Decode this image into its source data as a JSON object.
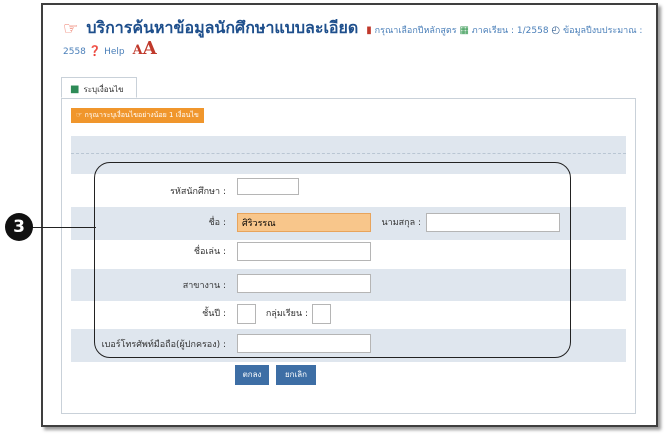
{
  "header": {
    "title": "บริการค้นหาข้อมูลนักศึกษาแบบละเอียด",
    "course_link": "กรุณาเลือกปีหลักสูตร",
    "term": "ภาคเรียน : 1/2558",
    "budget_year": "ข้อมูลปีงบประมาณ : 2558",
    "help": "Help",
    "font_small": "A",
    "font_large": "A"
  },
  "tab": {
    "label": "ระบุเงื่อนไข"
  },
  "warning": "กรุณาระบุเงื่อนไขอย่างน้อย 1 เงื่อนไข",
  "form": {
    "student_id_label": "รหัสนักศึกษา :",
    "student_id_value": "",
    "first_name_label": "ชื่อ :",
    "first_name_value": "ศิริวรรณ",
    "last_name_label": "นามสกุล :",
    "last_name_value": "",
    "nickname_label": "ชื่อเล่น :",
    "nickname_value": "",
    "major_label": "สาขางาน :",
    "major_value": "",
    "year_level_label": "ชั้นปี :",
    "year_level_value": "",
    "group_label": "กลุ่มเรียน :",
    "group_value": "",
    "parent_phone_label": "เบอร์โทรศัพท์มือถือ(ผู้ปกครอง) :",
    "parent_phone_value": ""
  },
  "buttons": {
    "submit": "ตกลง",
    "cancel": "ยกเลิก"
  },
  "callout": {
    "number": "3"
  }
}
